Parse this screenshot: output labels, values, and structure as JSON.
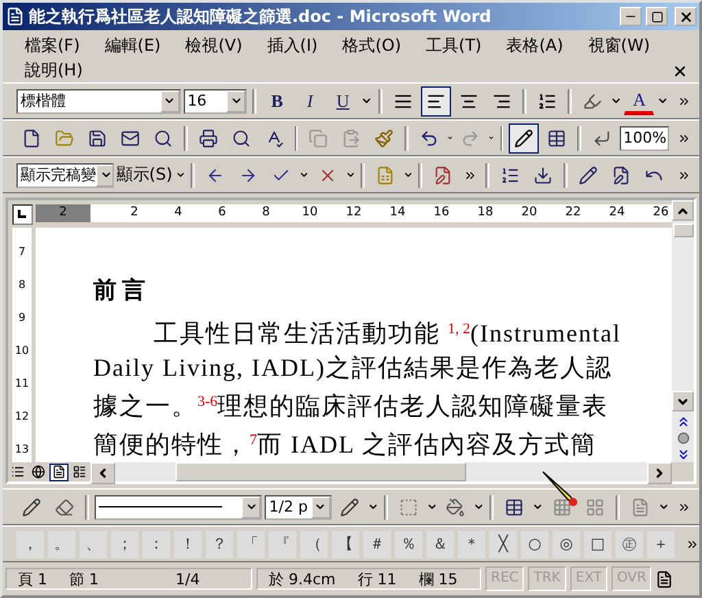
{
  "window": {
    "title": "能之執行爲社區老人認知障礙之篩選.doc - Microsoft Word"
  },
  "menu": [
    "檔案(F)",
    "編輯(E)",
    "檢視(V)",
    "插入(I)",
    "格式(O)",
    "工具(T)",
    "表格(A)",
    "視窗(W)",
    "說明(H)"
  ],
  "formatting_toolbar": {
    "font": "標楷體",
    "size": "16",
    "style_buttons": [
      {
        "label": "B",
        "kind": "bold"
      },
      {
        "label": "I",
        "kind": "italic"
      },
      {
        "label": "U",
        "kind": "underline"
      }
    ],
    "align_buttons": [
      {
        "selected": false
      },
      {
        "selected": true
      },
      {
        "selected": false
      },
      {
        "selected": false
      }
    ],
    "font_color_label": "A"
  },
  "standard_toolbar": {
    "edit_buttons": [
      {
        "disabled": true
      },
      {
        "disabled": true
      },
      {
        "disabled": false
      }
    ],
    "history_buttons": [
      {
        "disabled": false
      },
      {
        "disabled": true
      }
    ],
    "draw_table_selected": true,
    "zoom": "100%"
  },
  "reviewing_toolbar": {
    "display_mode": "顯示完稿變",
    "show_menu": "顯示(S)"
  },
  "ruler": {
    "horizontal": [
      "2",
      "2",
      "4",
      "6",
      "8",
      "10",
      "12",
      "14",
      "16",
      "18",
      "20",
      "22",
      "24",
      "26"
    ],
    "vertical": [
      "7",
      "8",
      "9",
      "10",
      "11",
      "12",
      "13"
    ]
  },
  "document": {
    "heading": "前言",
    "lines": [
      {
        "text": "工具性日常生活活動功能 $^{1, 2}$(Instrumental",
        "indent": true
      },
      {
        "text": "Daily Living, IADL)之評估結果是作為老人認",
        "indent": false
      },
      {
        "text": "據之一。$^{3-6}$理想的臨床評估老人認知障礙量表",
        "indent": false
      },
      {
        "text": "簡便的特性，$^{7}$而 IADL 之評估內容及方式簡",
        "indent": false
      }
    ]
  },
  "view_buttons": [
    {
      "selected": false
    },
    {
      "selected": false
    },
    {
      "selected": true
    },
    {
      "selected": false
    }
  ],
  "drawing_toolbar": {
    "line_weight": "1/2 p"
  },
  "symbols": [
    "，",
    "。",
    "、",
    "；",
    "：",
    "！",
    "？",
    "「",
    "『",
    "（",
    "【",
    "＃",
    "％",
    "＆",
    "＊",
    "╳",
    "○",
    "◎",
    "□",
    "㊣",
    "＋"
  ],
  "status_bar": {
    "page": "頁 1",
    "section": "節 1",
    "pages": "1/4",
    "position": "於 9.4cm",
    "line": "行 11",
    "column": "欄 15",
    "modes": [
      {
        "label": "REC",
        "on": false
      },
      {
        "label": "TRK",
        "on": false
      },
      {
        "label": "EXT",
        "on": false
      },
      {
        "label": "OVR",
        "on": false
      }
    ]
  }
}
